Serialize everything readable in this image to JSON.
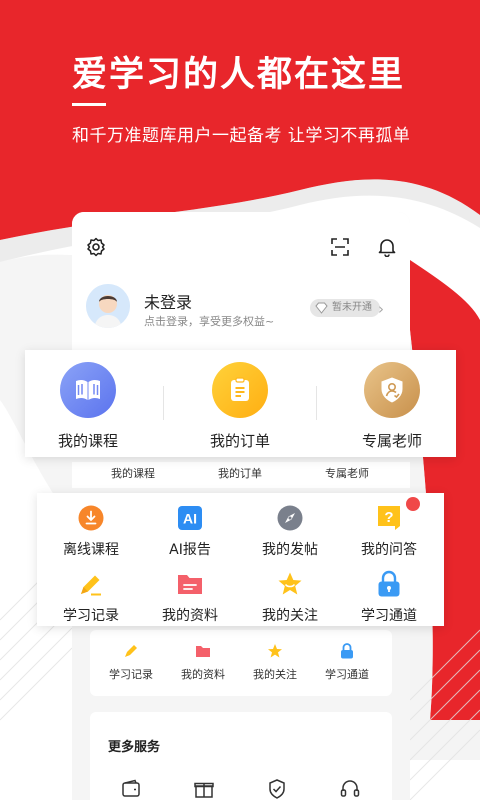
{
  "hero": {
    "title": "爱学习的人都在这里",
    "subtitle": "和千万准题库用户一起备考 让学习不再孤单"
  },
  "profile": {
    "name": "未登录",
    "hint": "点击登录，享受更多权益~",
    "vip_badge": "暂未开通"
  },
  "main_entries": [
    {
      "label": "我的课程",
      "icon": "book-icon"
    },
    {
      "label": "我的订单",
      "icon": "clipboard-icon"
    },
    {
      "label": "专属老师",
      "icon": "teacher-icon"
    }
  ],
  "ghost_entries": [
    "我的课程",
    "我的订单",
    "专属老师"
  ],
  "grid_entries": [
    {
      "label": "离线课程",
      "icon": "download-icon"
    },
    {
      "label": "AI报告",
      "icon": "ai-icon",
      "icon_text": "AI"
    },
    {
      "label": "我的发帖",
      "icon": "compass-icon"
    },
    {
      "label": "我的问答",
      "icon": "question-icon",
      "icon_text": "?"
    },
    {
      "label": "学习记录",
      "icon": "pencil-icon"
    },
    {
      "label": "我的资料",
      "icon": "folder-icon"
    },
    {
      "label": "我的关注",
      "icon": "star-icon"
    },
    {
      "label": "学习通道",
      "icon": "lock-icon"
    }
  ],
  "ghost_grid2": [
    "学习记录",
    "我的资料",
    "我的关注",
    "学习通道"
  ],
  "more_services": {
    "title": "更多服务",
    "icons": [
      "wallet-icon",
      "gift-icon",
      "shield-icon",
      "headset-icon"
    ]
  },
  "colors": {
    "brand_red": "#e8262b",
    "blue_gradient": [
      "#8ba3f7",
      "#5b73ee"
    ],
    "yellow_gradient": [
      "#ffd23a",
      "#ffae12"
    ],
    "gold_gradient": [
      "#e9c48a",
      "#c8904b"
    ],
    "badge_dot": "#f04848"
  }
}
